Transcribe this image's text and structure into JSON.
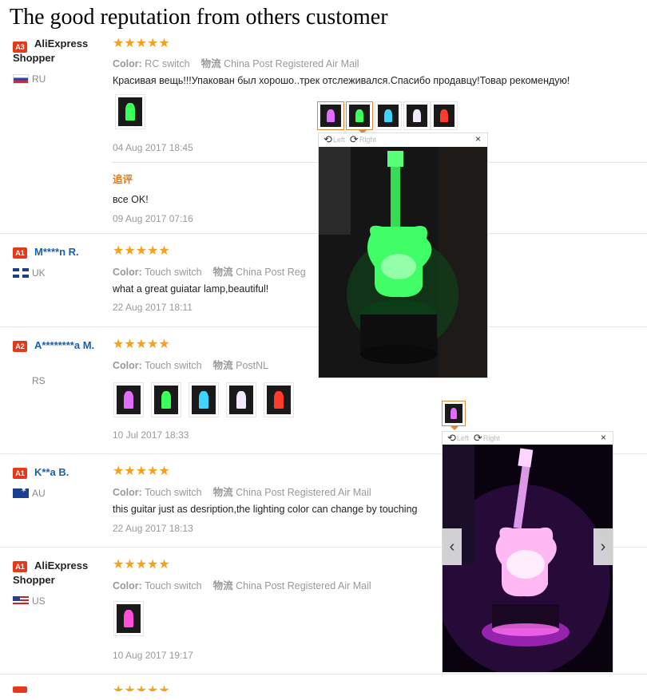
{
  "page_title": "The good reputation from others customer",
  "colors": {
    "star": "#f7a11a",
    "link_blue": "#1b5fa8",
    "badge_red": "#e4391b",
    "followup_orange": "#e47911"
  },
  "reviews": [
    {
      "level": "A3",
      "name": "AliExpress Shopper",
      "country": "RU",
      "flag": "flag-ru",
      "stars": "★★★★★",
      "color_label": "Color:",
      "color_value": "RC switch",
      "shipping_label": "物流",
      "shipping_value": "China Post Registered Air Mail",
      "text": "Красивая вещь!!!Упакован был хорошо..трек отслеживался.Спасибо продавцу!Товар рекомендую!",
      "date": "04 Aug 2017 18:45",
      "followup_label": "追评",
      "followup_text": "все OK!",
      "followup_date": "09 Aug 2017 07:16"
    },
    {
      "level": "A1",
      "name": "M****n R.",
      "country": "UK",
      "flag": "flag-uk",
      "stars": "★★★★★",
      "color_label": "Color:",
      "color_value": "Touch switch",
      "shipping_label": "物流",
      "shipping_value": "China Post Reg",
      "text": "what a great guiatar lamp,beautiful!",
      "date": "22 Aug 2017 18:11"
    },
    {
      "level": "A2",
      "name": "A********a M.",
      "country": "RS",
      "flag": "flag-none",
      "stars": "★★★★★",
      "color_label": "Color:",
      "color_value": "Touch switch",
      "shipping_label": "物流",
      "shipping_value": "PostNL",
      "date": "10 Jul 2017 18:33"
    },
    {
      "level": "A1",
      "name": "K**a B.",
      "country": "AU",
      "flag": "flag-au",
      "stars": "★★★★★",
      "color_label": "Color:",
      "color_value": "Touch switch",
      "shipping_label": "物流",
      "shipping_value": "China Post Registered Air Mail",
      "text": "this guitar just as desription,the lighting color can change by touching",
      "date": "22 Aug 2017 18:13"
    },
    {
      "level": "A1",
      "name": "AliExpress Shopper",
      "country": "US",
      "flag": "flag-us",
      "stars": "★★★★★",
      "color_label": "Color:",
      "color_value": "Touch switch",
      "shipping_label": "物流",
      "shipping_value": "China Post Registered Air Mail",
      "date": "10 Aug 2017 19:17"
    }
  ],
  "viewer": {
    "rotate_left": "Left",
    "rotate_right": "Right",
    "close": "×",
    "prev": "‹",
    "next": "›"
  },
  "thumb_glows": {
    "green": "#3bff5a",
    "pink": "#ff4fd8",
    "cyan": "#3fd3ff",
    "white": "#f2eaff",
    "red": "#ff3a2a",
    "violet": "#e16dff"
  }
}
